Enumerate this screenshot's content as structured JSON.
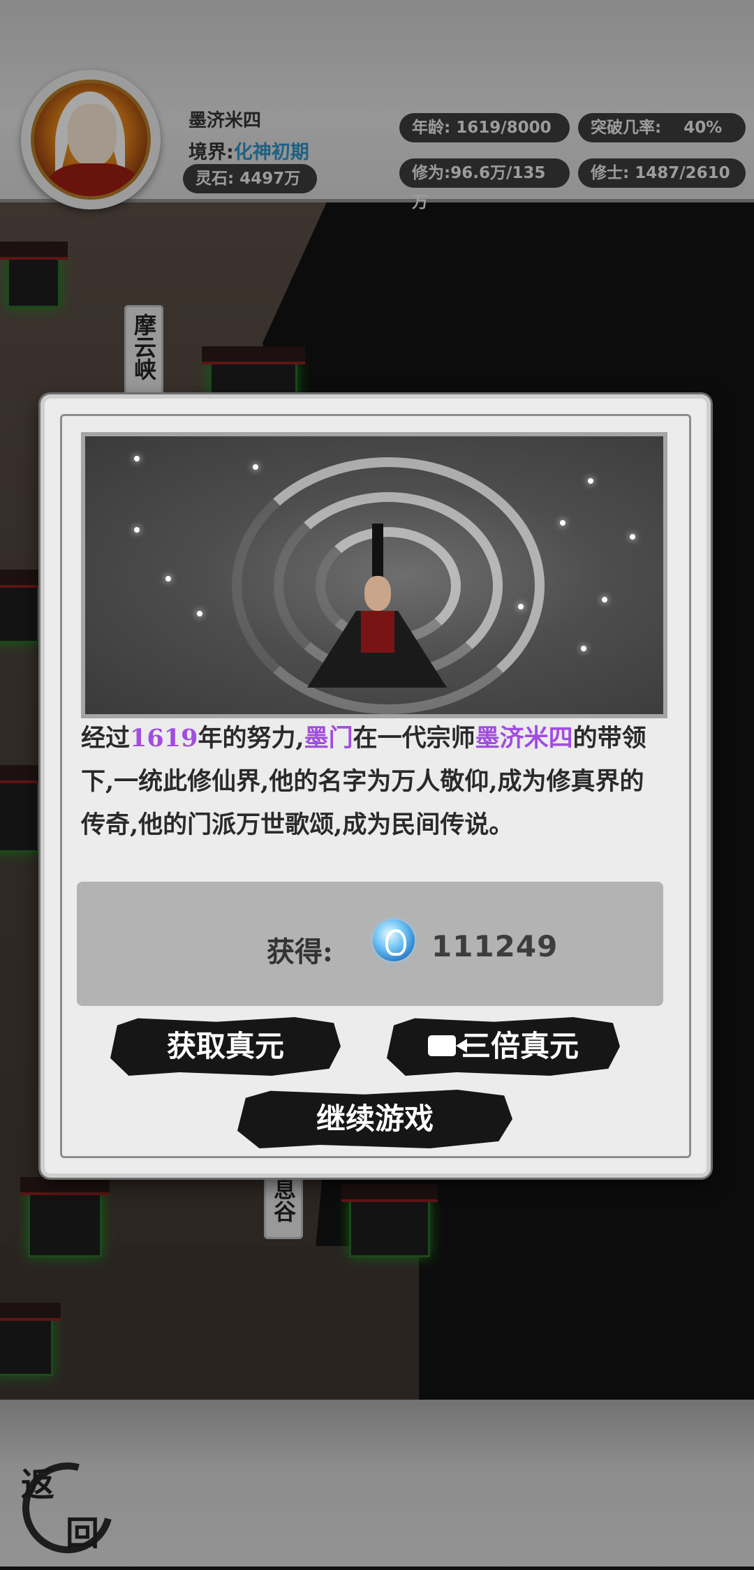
{
  "header": {
    "player_name": "墨济米四",
    "realm_label": "境界:",
    "realm_value": "化神初期",
    "spirit_stone": "灵石: 4497万",
    "age": "年龄: 1619/8000",
    "breakthrough": "突破几率:    40%",
    "cultivation": "修为:96.6万/135万",
    "disciples": "修士: 1487/2610"
  },
  "map": {
    "places": [
      "摩云峡",
      "息谷"
    ]
  },
  "modal": {
    "story": {
      "p1": "经过",
      "years": "1619",
      "p2": "年的努力,",
      "sect": "墨门",
      "p3": "在一代宗师",
      "master": "墨济米四",
      "p4": "的带领下,一统此修仙界,他的名字为万人敬仰,成为修真界的传奇,他的门派万世歌颂,成为民间传说。"
    },
    "reward_label": "获得:",
    "reward_amount": "111249",
    "reward_icon": "true-essence-orb-icon",
    "buttons": {
      "get": "获取真元",
      "triple": "三倍真元",
      "continue": "继续游戏"
    }
  },
  "bottom": {
    "back_char1": "返",
    "back_char2": "回"
  },
  "colors": {
    "highlight_purple": "#a14de0",
    "realm_blue": "#2f8fc2",
    "pill_bg": "#3b3b3b"
  }
}
